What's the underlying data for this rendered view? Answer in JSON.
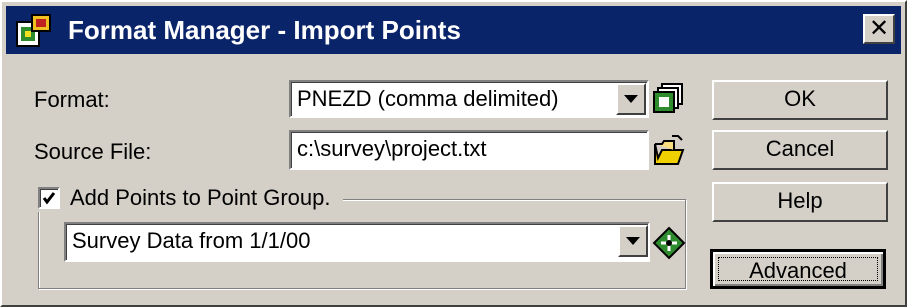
{
  "window": {
    "title": "Format Manager - Import Points",
    "close_label": "✕"
  },
  "form": {
    "format_label": "Format:",
    "format_value": "PNEZD (comma delimited)",
    "source_label": "Source File:",
    "source_value": "c:\\survey\\project.txt",
    "add_to_group_label": "Add Points to Point Group.",
    "add_to_group_checked": true,
    "group_value": "Survey Data from 1/1/00"
  },
  "buttons": {
    "ok": "OK",
    "cancel": "Cancel",
    "help": "Help",
    "advanced": "Advanced"
  },
  "icons": {
    "app": "format-manager-icon",
    "format_manage": "copy-formats-icon",
    "browse": "open-folder-icon",
    "point_group": "point-group-icon"
  },
  "colors": {
    "titlebar": "#0a246a",
    "dialog_face": "#d4d0c8",
    "field_bg": "#ffffff"
  }
}
